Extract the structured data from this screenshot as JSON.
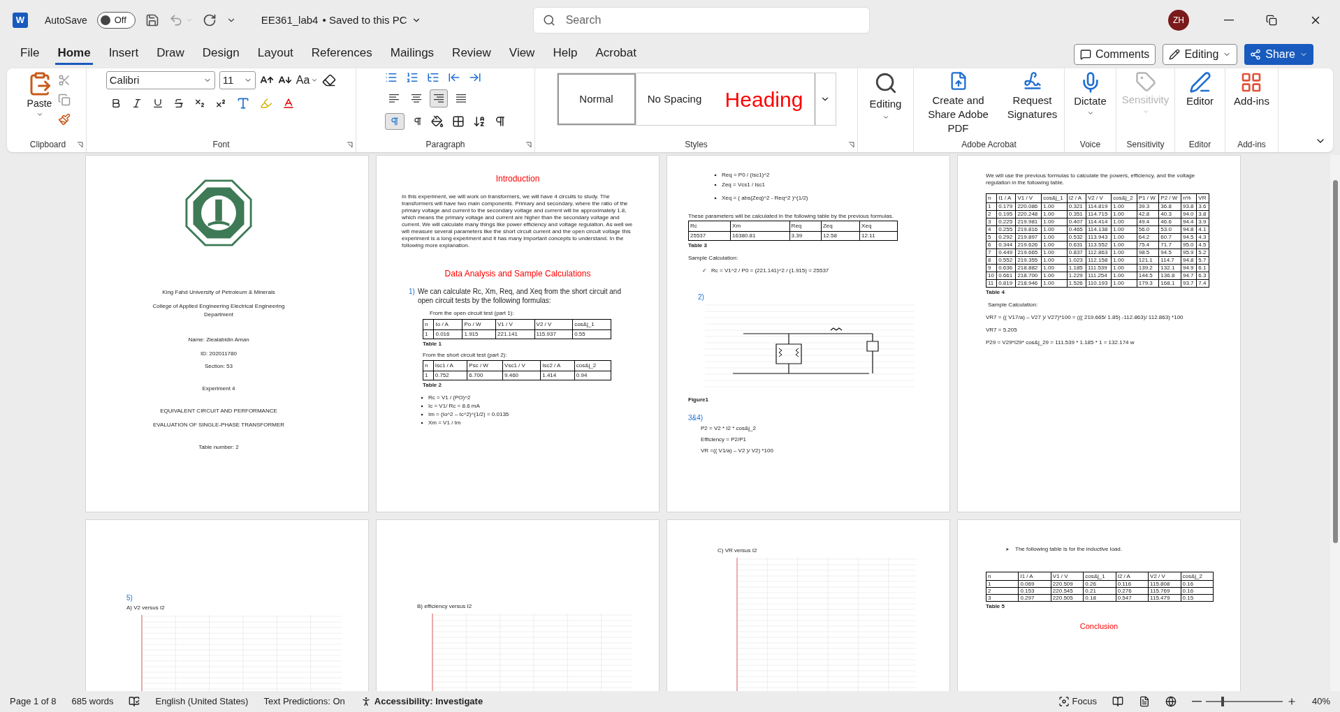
{
  "titlebar": {
    "logo": "W",
    "autosave_label": "AutoSave",
    "autosave": {
      "label": "Off",
      "on": false
    },
    "filename": "EE361_lab4",
    "save_status": "• Saved to this PC",
    "search_placeholder": "Search",
    "avatar": "ZH"
  },
  "menu_tabs": [
    {
      "label": "File",
      "selected": false
    },
    {
      "label": "Home",
      "selected": true
    },
    {
      "label": "Insert",
      "selected": false
    },
    {
      "label": "Draw",
      "selected": false
    },
    {
      "label": "Design",
      "selected": false
    },
    {
      "label": "Layout",
      "selected": false
    },
    {
      "label": "References",
      "selected": false
    },
    {
      "label": "Mailings",
      "selected": false
    },
    {
      "label": "Review",
      "selected": false
    },
    {
      "label": "View",
      "selected": false
    },
    {
      "label": "Help",
      "selected": false
    },
    {
      "label": "Acrobat",
      "selected": false
    }
  ],
  "top_buttons": {
    "comments": "Comments",
    "editing": "Editing",
    "share": "Share"
  },
  "ribbon": {
    "clipboard": {
      "paste": "Paste",
      "label": "Clipboard"
    },
    "font": {
      "name": "Calibri",
      "size": "11",
      "change_case": "Aa",
      "label": "Font"
    },
    "paragraph": {
      "label": "Paragraph",
      "alignment": [
        {
          "selected": false
        },
        {
          "selected": false
        },
        {
          "selected": true
        },
        {
          "selected": false
        }
      ],
      "ltr": {
        "selected": true
      }
    },
    "styles": {
      "label": "Styles",
      "items": [
        {
          "label": "Normal",
          "kind": "normal",
          "selected": true
        },
        {
          "label": "No Spacing",
          "kind": "plain",
          "selected": false
        },
        {
          "label": "Heading",
          "kind": "heading",
          "selected": false
        }
      ]
    },
    "editing": "Editing",
    "adobe": {
      "create": "Create and Share Adobe PDF",
      "request": "Request Signatures",
      "label": "Adobe Acrobat"
    },
    "voice": {
      "dictate": "Dictate",
      "label": "Voice"
    },
    "sensitivity": {
      "button": "Sensitivity",
      "disabled": true,
      "label": "Sensitivity"
    },
    "editor": {
      "button": "Editor",
      "label": "Editor"
    },
    "addins": {
      "button": "Add-ins",
      "label": "Add-ins"
    }
  },
  "pages": [
    {
      "kind": "cover",
      "lines": [
        "King Fahd University of Petroleum & Minerals",
        "College of Applied Engineering Electrical Engineering Department",
        "Name: Ziealabidin Aman",
        "ID: 202011780",
        "Section: 53",
        "Experiment 4",
        "EQUIVALENT CIRCUIT AND PERFORMANCE",
        "EVALUATION OF SINGLE-PHASE TRANSFORMER",
        "Table number: 2"
      ]
    },
    {
      "kind": "intro",
      "heading": "Introduction",
      "paragraph": "In this experiment, we will work on transformers, we will have 4 circuits to study. The transformers will have two main components. Primary and secondary, where the ratio of the primary voltage and current to the secondary voltage and current will be approximately 1.8, which means the primary voltage and current are higher than the secondary voltage and current. We will calculate many things like power efficiency and voltage regulation. As well we will measure several parameters like the short circuit current and the open circuit voltage this experiment is a long experiment and it has many important concepts to understand. In the following more explanation.",
      "heading2": "Data Analysis and Sample Calculations",
      "item_number": "1)",
      "item_text": "We can calculate Rc, Xm, Req, and Xeq from the short circuit and open circuit tests by the following formulas:",
      "caption1": "From the open circuit test (part 1):",
      "table1": {
        "columns": [
          "n",
          "Io / A",
          "Po / W",
          "V1 / V",
          "V2 / V",
          "cos&j_1"
        ],
        "rows": [
          [
            "1",
            "0.016",
            "1.915",
            "221.141",
            "115.937",
            "0.55"
          ]
        ],
        "label": "Table 1"
      },
      "caption2": "From the short circuit test (part 2):",
      "table2": {
        "columns": [
          "n",
          "Isc1 / A",
          "Psc / W",
          "Vsc1 / V",
          "Isc2 / A",
          "cos&j_2"
        ],
        "rows": [
          [
            "1",
            "0.752",
            "6.700",
            "9.460",
            "1.414",
            "0.94"
          ]
        ],
        "label": "Table 2"
      },
      "bullets": [
        "Rc = V1 / (PO)^2",
        "Ic = V1/ Rc = 8.6 mA",
        "Im = (Io^2 – Ic^2)^(1/2) = 0.0135",
        "Xm = V1 / Im"
      ]
    },
    {
      "kind": "calc",
      "bullets": [
        "Req = P0 / (Isc1)^2",
        "Zeq = Vcs1 / Isc1",
        "Xeq = ( abs(Zeq)^2 - Req^2 )^(1/2)"
      ],
      "caption": "These parameters will be calculated in the following table by the previous formulas.",
      "table3": {
        "columns": [
          "Rc",
          "Xm",
          "Req",
          "Zeq",
          "Xeq"
        ],
        "rows": [
          [
            "25537",
            "16380.81",
            "3.39",
            "12.58",
            "12.11"
          ]
        ],
        "label": "Table 3"
      },
      "sample": "Sample Calculation:",
      "check": "✓",
      "check_text": "Rc = V1^2 / P0 = (221.141)^2 / (1.915) = 25537",
      "section2": "2)",
      "figure": "Figure1",
      "section3": "3&4)",
      "formulas": [
        "P2 = V2 * I2 * cos&j_2",
        "Efficiency = P2/P1",
        "VR =(( V1/a) – V2 )/ V2) *100"
      ]
    },
    {
      "kind": "results",
      "intro": "We will use the previous formulas to calculate the powers, efficiency, and the voltage regulation in the following table.",
      "table4": {
        "columns": [
          "n",
          "I1 / A",
          "V1 / V",
          "cos&j_1",
          "I2 / A",
          "V2 / V",
          "cos&j_2",
          "P1 / W",
          "P2 / W",
          "n%",
          "VR"
        ],
        "rows": [
          [
            "1",
            "0.179",
            "220.086",
            "1.00",
            "0.321",
            "114.819",
            "1.00",
            "39.3",
            "36.8",
            "93.8",
            "3.6"
          ],
          [
            "2",
            "0.195",
            "220.248",
            "1.00",
            "0.351",
            "114.715",
            "1.00",
            "42.8",
            "40.3",
            "94.0",
            "3.8"
          ],
          [
            "3",
            "0.225",
            "219.981",
            "1.00",
            "0.407",
            "114.414",
            "1.00",
            "49.4",
            "46.6",
            "94.4",
            "3.9"
          ],
          [
            "4",
            "0.255",
            "219.816",
            "1.00",
            "0.465",
            "114.138",
            "1.00",
            "56.0",
            "53.0",
            "94.8",
            "4.1"
          ],
          [
            "5",
            "0.292",
            "219.897",
            "1.00",
            "0.532",
            "113.943",
            "1.00",
            "64.2",
            "60.7",
            "94.5",
            "4.3"
          ],
          [
            "6",
            "0.344",
            "219.626",
            "1.00",
            "0.631",
            "113.552",
            "1.00",
            "75.4",
            "71.7",
            "95.0",
            "4.5"
          ],
          [
            "7",
            "0.449",
            "219.665",
            "1.00",
            "0.837",
            "112.863",
            "1.00",
            "98.5",
            "94.5",
            "95.9",
            "5.2"
          ],
          [
            "8",
            "0.552",
            "219.355",
            "1.00",
            "1.023",
            "112.158",
            "1.00",
            "121.1",
            "114.7",
            "94.8",
            "5.7"
          ],
          [
            "9",
            "0.636",
            "218.882",
            "1.00",
            "1.185",
            "111.539",
            "1.00",
            "139.2",
            "132.1",
            "94.9",
            "6.1"
          ],
          [
            "10",
            "0.661",
            "218.700",
            "1.00",
            "1.229",
            "111.254",
            "1.00",
            "144.5",
            "136.8",
            "94.7",
            "6.3"
          ],
          [
            "11",
            "0.819",
            "218.946",
            "1.00",
            "1.526",
            "110.193",
            "1.00",
            "179.3",
            "168.1",
            "93.7",
            "7.4"
          ]
        ],
        "label": "Table 4"
      },
      "sample": "Sample Calculation:",
      "lines": [
        "VR7 = (( V17/a) – V27 )/ V27)*100 = ((( 219.665/ 1.85) -112.863)/ 112.863) *100",
        "VR7 = 5.205",
        "P29 = V29*I29* cos&j_29 = 111.539 * 1.185 * 1 = 132.174 w"
      ]
    },
    {
      "kind": "graph",
      "section": "5)",
      "caption": "A) V2 versus I2"
    },
    {
      "kind": "graph",
      "caption": "B) efficiency versus I2"
    },
    {
      "kind": "graph_top",
      "caption": "C) VR versus I2"
    },
    {
      "kind": "inductive",
      "bullet": "The following table is for the inductive load.",
      "table5": {
        "columns": [
          "n",
          "I1 / A",
          "V1 / V",
          "cos&j_1",
          "I2 / A",
          "V2 / V",
          "cos&j_2"
        ],
        "rows": [
          [
            "1",
            "0.069",
            "220.509",
            "0.26",
            "0.116",
            "115.808",
            "0.16"
          ],
          [
            "2",
            "0.153",
            "220.545",
            "0.21",
            "0.276",
            "115.769",
            "0.16"
          ],
          [
            "3",
            "0.297",
            "220.505",
            "0.18",
            "0.547",
            "115.479",
            "0.15"
          ]
        ],
        "label": "Table 5"
      },
      "heading": "Conclusion"
    }
  ],
  "status_bar": {
    "page": "Page 1 of 8",
    "words": "685 words",
    "language": "English (United States)",
    "predictions": "Text Predictions: On",
    "accessibility": "Accessibility: Investigate",
    "focus": "Focus",
    "zoom": "40%",
    "zoom_slider": {
      "level": 0.2
    }
  }
}
